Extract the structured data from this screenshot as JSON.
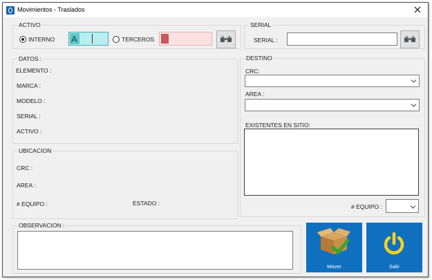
{
  "window": {
    "title": "Movimientos - Traslados"
  },
  "activo": {
    "legend": "ACTIVO",
    "interno_label": "INTERNO",
    "interno_checked": true,
    "code_value": "A",
    "terceros_label": "TERCEROS",
    "terceros_checked": false,
    "terceros_value": "",
    "search_icon": "binoculars-icon"
  },
  "serial": {
    "legend": "SERIAL",
    "label": "SERIAL :",
    "value": "",
    "search_icon": "binoculars-icon"
  },
  "datos": {
    "legend": "DATOS :",
    "labels": [
      "ELEMENTO :",
      "MARCA :",
      "MODELO :",
      "SERIAL :",
      "ACTIVO :"
    ]
  },
  "ubicacion": {
    "legend": "UBICACION",
    "crc_label": "CRC :",
    "area_label": "AREA :",
    "equipo_label": "# EQUIPO :",
    "estado_label": "ESTADO :"
  },
  "destino": {
    "legend": "DESTINO",
    "crc_label": "CRC:",
    "crc_value": "",
    "area_label": "AREA :",
    "area_value": "",
    "existentes_label": "EXISTENTES EN SITIO:"
  },
  "equipo": {
    "label": "# EQUIPO :",
    "value": ""
  },
  "observacion": {
    "label": "OBSERVACION :",
    "value": ""
  },
  "actions": {
    "mover_label": "Mover",
    "salir_label": "Salir"
  },
  "colors": {
    "accent_blue": "#1070c0",
    "code_field": "#b8eef0",
    "terceros_field": "#fde1e1",
    "terceros_marker": "#c8585b",
    "power_yellow": "#f8d21c",
    "check_green": "#3da32f"
  }
}
